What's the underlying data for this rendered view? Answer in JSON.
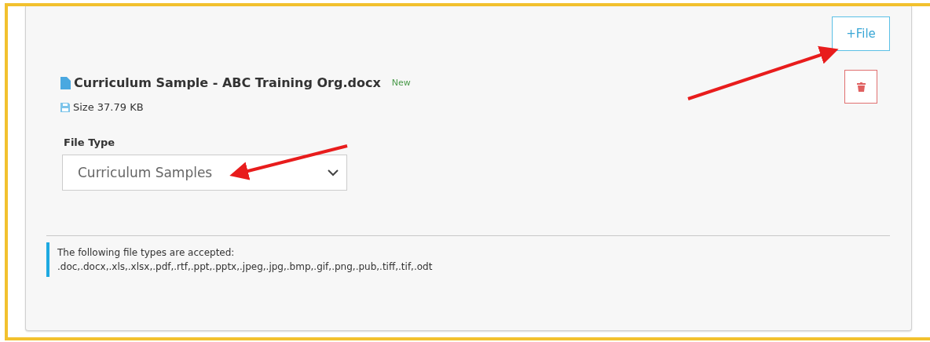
{
  "add_button": {
    "label": "+File"
  },
  "file": {
    "name": "Curriculum Sample - ABC Training Org.docx",
    "badge": "New",
    "size": "Size 37.79 KB"
  },
  "file_type": {
    "label": "File Type",
    "value": "Curriculum Samples"
  },
  "note": {
    "title": "The following file types are accepted:",
    "types": ".doc,.docx,.xls,.xlsx,.pdf,.rtf,.ppt,.pptx,.jpeg,.jpg,.bmp,.gif,.png,.pub,.tiff,.tif,.odt"
  }
}
